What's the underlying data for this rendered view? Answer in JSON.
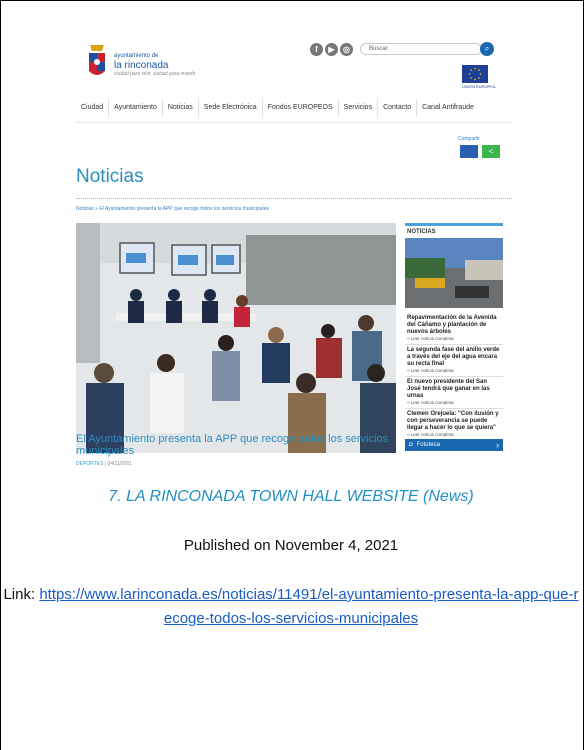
{
  "screenshot": {
    "brand_small": "ayuntamiento de",
    "brand_name": "la rinconada",
    "brand_tagline": "ciudad para vivir, ciudad para invertir",
    "search_placeholder": "Buscar",
    "eu_label": "UNIÓN EUROPEA",
    "nav": [
      "Ciudad",
      "Ayuntamiento",
      "Noticias",
      "Sede Electrónica",
      "Fondos EUROPEOS",
      "Servicios",
      "Contacto",
      "Canal Antifraude"
    ],
    "share_label": "Compartir",
    "page_title": "Noticias",
    "breadcrumb": "Noticias  »  El Ayuntamiento presenta la APP que recoge todos los servicios municipales",
    "main_caption": "El Ayuntamiento presenta la APP que recoge todos los servicios municipales",
    "category": "DEPORTES",
    "date": "04/11/2021",
    "sidebar_title": "NOTICIAS",
    "sidebar_items": [
      {
        "title": "Repavimentación de la Avenida del Cáñamo y plantación de nuevos árboles",
        "link": "» Leer noticia completa"
      },
      {
        "title": "La segunda fase del anillo verde a través del eje del agua encara su recta final",
        "link": "» Leer noticia completa"
      },
      {
        "title": "El nuevo presidente del San José tendrá que ganar en las urnas",
        "link": "» Leer noticia completa"
      },
      {
        "title": "Clemen Orejuela: \"Con ilusión y con perseverancia se puede llegar a hacer lo que se quiera\"",
        "link": "» Leer noticia completa"
      }
    ],
    "fototeca": "Fototeca"
  },
  "figure_title": "7. LA RINCONADA TOWN HALL WEBSITE (News)",
  "published": "Published on November 4, 2021",
  "link_label": "Link: ",
  "link_url": "https://www.larinconada.es/noticias/11491/el-ayuntamiento-presenta-la-app-que-recoge-todos-los-servicios-municipales"
}
